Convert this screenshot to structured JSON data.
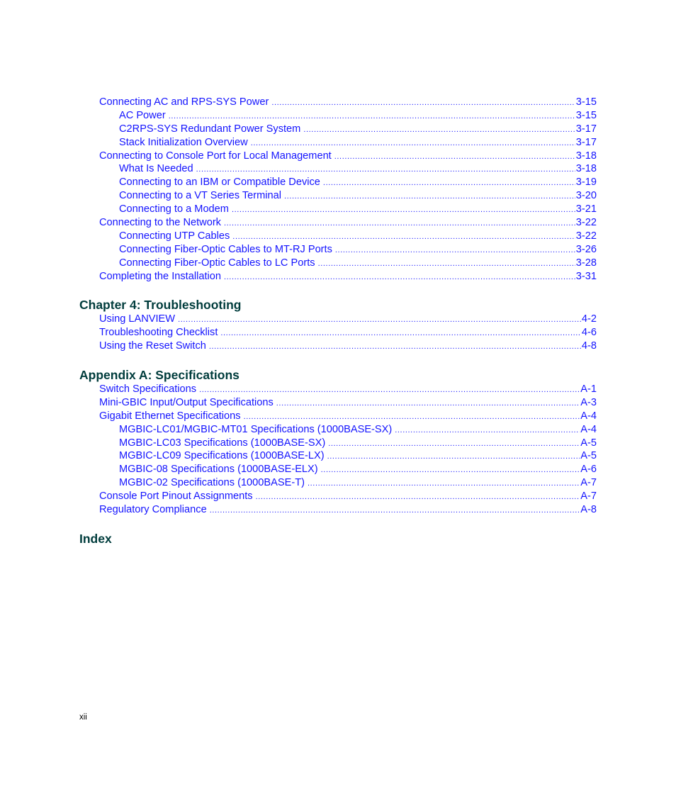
{
  "chapter3_continued": [
    {
      "level": 1,
      "title": "Connecting AC and RPS-SYS Power",
      "page": "3-15"
    },
    {
      "level": 2,
      "title": "AC Power",
      "page": "3-15"
    },
    {
      "level": 2,
      "title": "C2RPS-SYS Redundant Power System",
      "page": "3-17"
    },
    {
      "level": 2,
      "title": "Stack Initialization Overview",
      "page": "3-17"
    },
    {
      "level": 1,
      "title": "Connecting to Console Port for Local Management",
      "page": "3-18"
    },
    {
      "level": 2,
      "title": "What Is Needed",
      "page": "3-18"
    },
    {
      "level": 2,
      "title": "Connecting to an IBM or Compatible Device",
      "page": "3-19"
    },
    {
      "level": 2,
      "title": "Connecting to a VT Series Terminal",
      "page": "3-20"
    },
    {
      "level": 2,
      "title": "Connecting to a Modem",
      "page": "3-21"
    },
    {
      "level": 1,
      "title": "Connecting to the Network",
      "page": "3-22"
    },
    {
      "level": 2,
      "title": "Connecting UTP Cables",
      "page": "3-22"
    },
    {
      "level": 2,
      "title": "Connecting Fiber-Optic Cables to MT-RJ Ports",
      "page": "3-26"
    },
    {
      "level": 2,
      "title": "Connecting Fiber-Optic Cables to LC Ports",
      "page": "3-28"
    },
    {
      "level": 1,
      "title": "Completing the Installation",
      "page": "3-31"
    }
  ],
  "chapter4": {
    "heading": "Chapter 4: Troubleshooting",
    "entries": [
      {
        "level": 1,
        "title": "Using LANVIEW",
        "page": "4-2"
      },
      {
        "level": 1,
        "title": "Troubleshooting Checklist",
        "page": "4-6"
      },
      {
        "level": 1,
        "title": "Using the Reset Switch",
        "page": "4-8"
      }
    ]
  },
  "appendixA": {
    "heading": "Appendix A: Specifications",
    "entries": [
      {
        "level": 1,
        "title": "Switch Specifications",
        "page": "A-1"
      },
      {
        "level": 1,
        "title": "Mini-GBIC Input/Output Specifications",
        "page": "A-3"
      },
      {
        "level": 1,
        "title": "Gigabit Ethernet Specifications",
        "page": "A-4"
      },
      {
        "level": 2,
        "title": "MGBIC-LC01/MGBIC-MT01 Specifications (1000BASE-SX)",
        "page": "A-4"
      },
      {
        "level": 2,
        "title": "MGBIC-LC03 Specifications (1000BASE-SX)",
        "page": "A-5"
      },
      {
        "level": 2,
        "title": "MGBIC-LC09 Specifications (1000BASE-LX)",
        "page": "A-5"
      },
      {
        "level": 2,
        "title": "MGBIC-08 Specifications (1000BASE-ELX)",
        "page": "A-6"
      },
      {
        "level": 2,
        "title": "MGBIC-02 Specifications (1000BASE-T)",
        "page": "A-7"
      },
      {
        "level": 1,
        "title": "Console Port Pinout Assignments",
        "page": "A-7"
      },
      {
        "level": 1,
        "title": "Regulatory Compliance",
        "page": "A-8"
      }
    ]
  },
  "index": {
    "heading": "Index"
  },
  "folio": "xii",
  "colors": {
    "link": "#1414ff",
    "heading": "#003c3c"
  }
}
